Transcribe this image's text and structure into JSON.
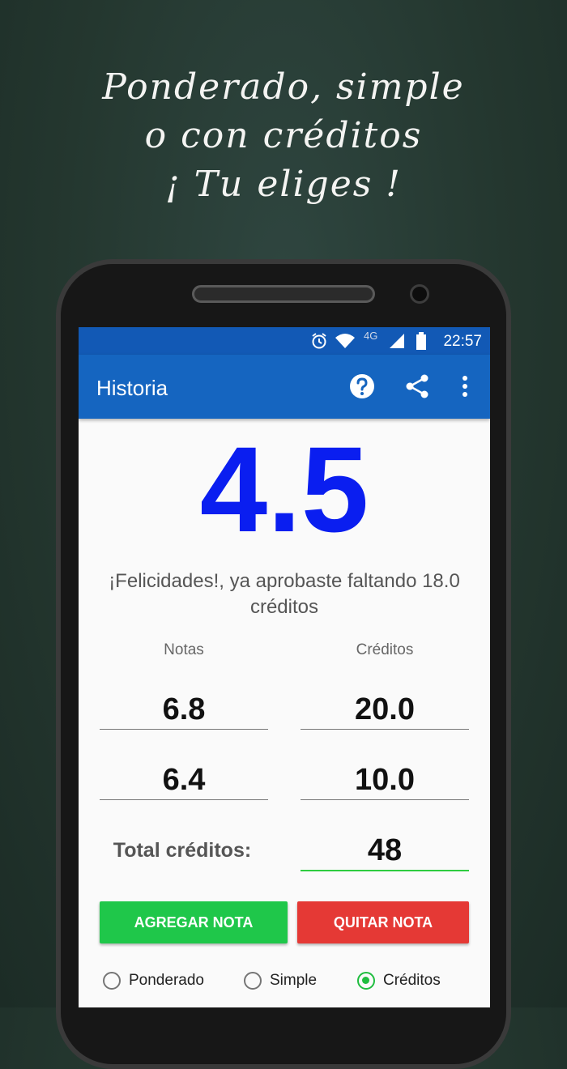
{
  "headline": {
    "line1": "Ponderado, simple",
    "line2": "o con créditos",
    "line3": "¡ Tu eliges !"
  },
  "status_bar": {
    "network": "4G",
    "time": "22:57",
    "icons": [
      "alarm-icon",
      "wifi-icon",
      "signal-icon",
      "battery-icon"
    ]
  },
  "app_bar": {
    "title": "Historia",
    "actions": [
      "help-icon",
      "share-icon",
      "overflow-menu-icon"
    ]
  },
  "result": {
    "grade": "4.5",
    "message": "¡Felicidades!, ya aprobaste faltando 18.0 créditos",
    "grade_color": "#0a1ef0"
  },
  "table": {
    "headers": [
      "Notas",
      "Créditos"
    ],
    "rows": [
      {
        "nota": "6.8",
        "creditos": "20.0"
      },
      {
        "nota": "6.4",
        "creditos": "10.0"
      }
    ]
  },
  "total": {
    "label": "Total créditos:",
    "value": "48"
  },
  "buttons": {
    "add_label": "AGREGAR NOTA",
    "remove_label": "QUITAR NOTA",
    "add_color": "#1fc74a",
    "remove_color": "#e53935"
  },
  "mode": {
    "options": [
      "Ponderado",
      "Simple",
      "Créditos"
    ],
    "selected": "Créditos"
  },
  "colors": {
    "primary": "#1565c0",
    "accent": "#1fbd3f"
  }
}
